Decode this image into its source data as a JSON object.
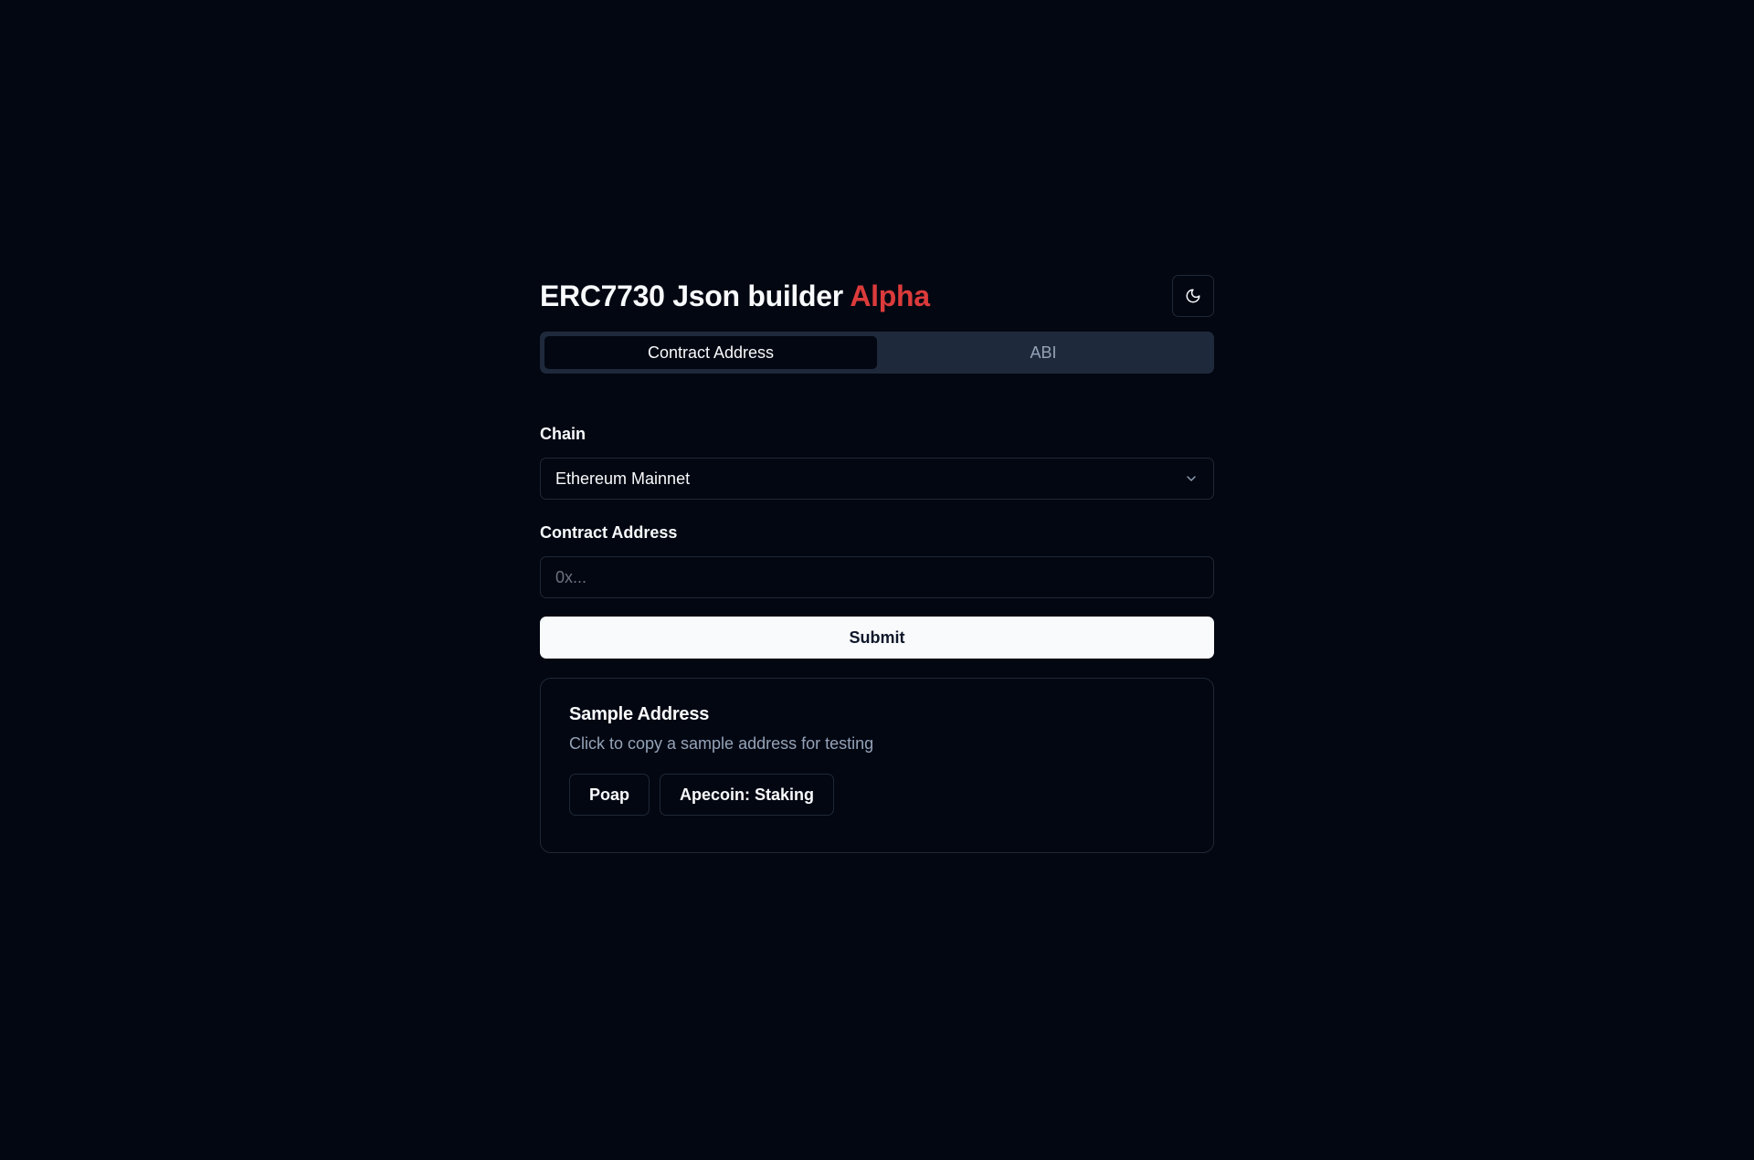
{
  "header": {
    "title": "ERC7730 Json builder",
    "badge": "Alpha",
    "theme_icon": "moon-icon"
  },
  "tabs": [
    {
      "label": "Contract Address",
      "active": true
    },
    {
      "label": "ABI",
      "active": false
    }
  ],
  "form": {
    "chain_label": "Chain",
    "chain_value": "Ethereum Mainnet",
    "chain_icon": "chevron-down-icon",
    "address_label": "Contract Address",
    "address_placeholder": "0x...",
    "address_value": "",
    "submit_label": "Submit"
  },
  "sample": {
    "title": "Sample Address",
    "description": "Click to copy a sample address for testing",
    "buttons": [
      {
        "label": "Poap"
      },
      {
        "label": "Apecoin: Staking"
      }
    ]
  },
  "colors": {
    "background": "#030712",
    "accent": "#dc3b3b",
    "border": "#1f2937",
    "tabs_bg": "#1e293b",
    "muted_text": "#94a3b8",
    "primary_button": "#f8fafc"
  }
}
